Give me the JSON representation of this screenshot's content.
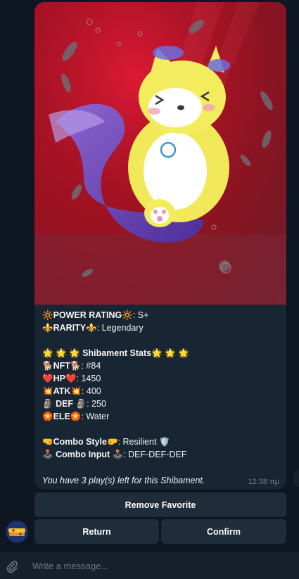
{
  "message": {
    "lines": {
      "power_rating": {
        "emoji": "🔆",
        "label": "POWER RATING",
        "value": ": S+"
      },
      "rarity": {
        "emoji": "⚜️",
        "label": "RARITY",
        "value": ": Legendary"
      },
      "stats_title": {
        "emoji": "🌟 🌟 🌟",
        "label": "Shibament Stats",
        "emoji_after": "🌟 🌟 🌟"
      },
      "nft": {
        "emoji": "🐕",
        "label": "NFT",
        "value": ": #84"
      },
      "hp": {
        "emoji": "❤️",
        "label": "HP",
        "value": ":  1450"
      },
      "atk": {
        "emoji": "💥",
        "label": "ATK",
        "value": ": 400"
      },
      "def": {
        "emoji": "🗿",
        "label": "DEF",
        "value": ": 250"
      },
      "ele": {
        "emoji": "🏵️",
        "label": "ELE",
        "value": ": Water"
      },
      "combo_style": {
        "emoji": "🤜",
        "emoji_after": "🤛",
        "label": "Combo Style",
        "value": ": Resilient",
        "trail_emoji": "🛡️"
      },
      "combo_input": {
        "emoji": "🕹️",
        "label": "Combo Input",
        "value": ": DEF-DEF-DEF"
      }
    },
    "footer": "You have 3 play(s) left for this Shibament.",
    "time": "12:38 πμ"
  },
  "buttons": {
    "remove_favorite": "Remove Favorite",
    "return": "Return",
    "confirm": "Confirm"
  },
  "composer": {
    "placeholder": "Write a message..."
  },
  "icons": {
    "attach": "paperclip-icon",
    "avatar": "shibament-bot-avatar"
  },
  "colors": {
    "background": "#0e1621",
    "bubble": "#182533",
    "button": "#1f2c3a",
    "art_red": "#a01020",
    "time": "#6d7f8f"
  }
}
